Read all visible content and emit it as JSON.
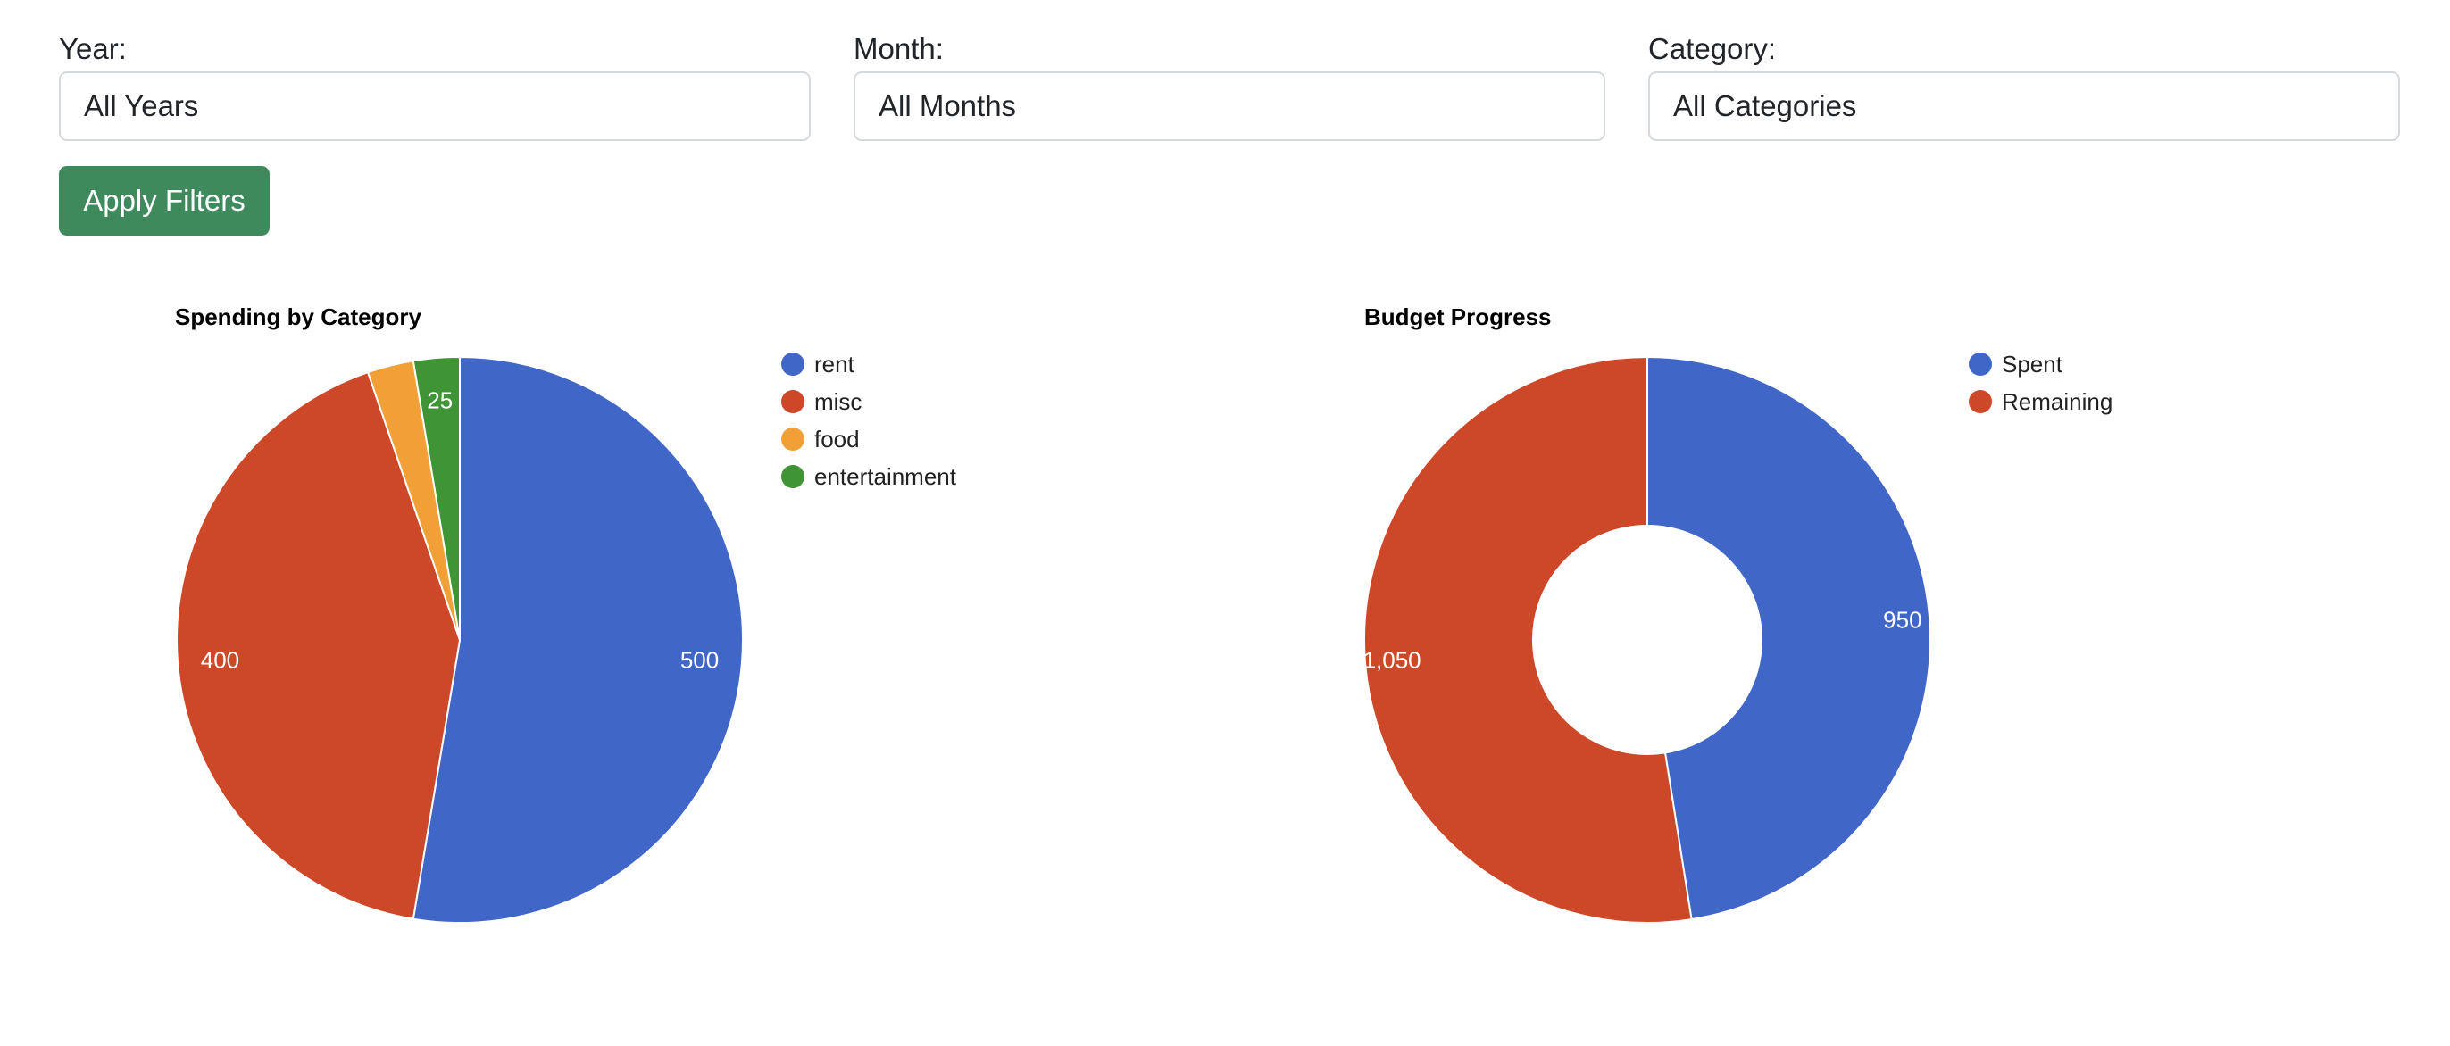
{
  "filters": {
    "year": {
      "label": "Year:",
      "value": "All Years"
    },
    "month": {
      "label": "Month:",
      "value": "All Months"
    },
    "category": {
      "label": "Category:",
      "value": "All Categories"
    }
  },
  "apply_button": "Apply Filters",
  "chart_data": [
    {
      "type": "pie",
      "title": "Spending by Category",
      "categories": [
        "rent",
        "misc",
        "food",
        "entertainment"
      ],
      "values": [
        500,
        400,
        25,
        25
      ],
      "data_labels": [
        "500",
        "400",
        "",
        "25"
      ],
      "colors": [
        "#4066c7",
        "#cc4829",
        "#f0a037",
        "#3f9535"
      ],
      "legend_position": "right"
    },
    {
      "type": "pie",
      "donut": true,
      "title": "Budget Progress",
      "categories": [
        "Spent",
        "Remaining"
      ],
      "values": [
        950,
        1050
      ],
      "data_labels": [
        "950",
        "1,050"
      ],
      "colors": [
        "#4066c7",
        "#cc4829"
      ],
      "legend_position": "right"
    }
  ]
}
